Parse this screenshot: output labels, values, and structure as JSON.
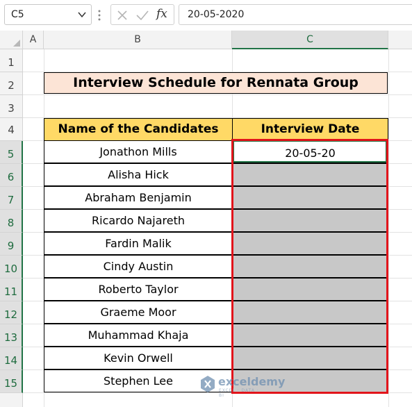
{
  "formula_bar": {
    "name_box": "C5",
    "fx_label": "fx",
    "formula": "20-05-2020"
  },
  "columns": [
    "A",
    "B",
    "C"
  ],
  "rows": [
    "1",
    "2",
    "3",
    "4",
    "5",
    "6",
    "7",
    "8",
    "9",
    "10",
    "11",
    "12",
    "13",
    "14",
    "15"
  ],
  "sheet": {
    "title": "Interview Schedule for Rennata Group",
    "header": {
      "name": "Name of the Candidates",
      "date": "Interview Date"
    },
    "candidates": [
      "Jonathon Mills",
      "Alisha Hick",
      "Abraham Benjamin",
      "Ricardo Najareth",
      "Fardin Malik",
      "Cindy Austin",
      "Roberto Taylor",
      "Graeme Moor",
      "Muhammad Khaja",
      "Kevin Orwell",
      "Stephen Lee"
    ],
    "dates": [
      "20-05-20",
      "",
      "",
      "",
      "",
      "",
      "",
      "",
      "",
      "",
      ""
    ]
  },
  "selection": {
    "cell": "C5",
    "column": "C",
    "row": "5"
  },
  "colors": {
    "title_fill": "#fce4d6",
    "header_fill": "#ffd966",
    "empty_date_fill": "#c8c8c8",
    "highlight_border": "#e2141b",
    "excel_green": "#217346"
  },
  "watermark": {
    "brand": "exceldemy",
    "tagline": "EXCEL · DATA · BI"
  }
}
